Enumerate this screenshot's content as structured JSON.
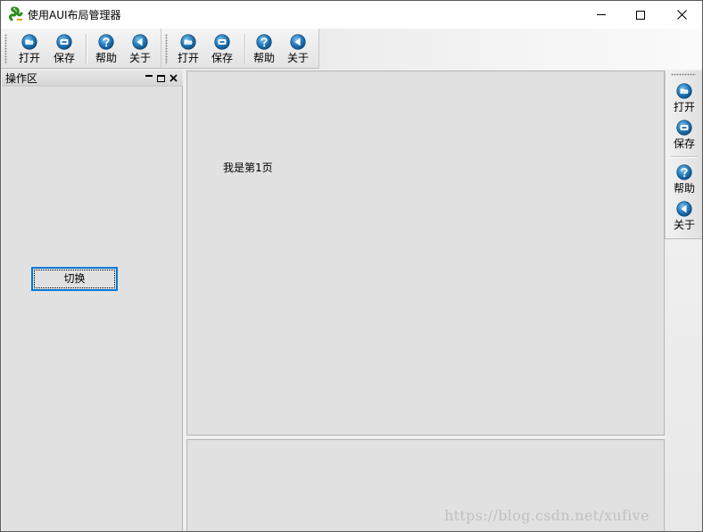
{
  "window": {
    "title": "使用AUI布局管理器",
    "app_icon": "snake-app-icon",
    "controls": {
      "minimize": "minimize-icon",
      "maximize": "maximize-icon",
      "close": "close-icon"
    }
  },
  "toolbar1": {
    "buttons": [
      {
        "label": "打开",
        "icon": "open-folder-icon"
      },
      {
        "label": "保存",
        "icon": "save-icon"
      },
      {
        "label": "帮助",
        "icon": "help-icon"
      },
      {
        "label": "关于",
        "icon": "back-arrow-icon"
      }
    ]
  },
  "toolbar2": {
    "buttons": [
      {
        "label": "打开",
        "icon": "open-folder-icon"
      },
      {
        "label": "保存",
        "icon": "save-icon"
      },
      {
        "label": "帮助",
        "icon": "help-icon"
      },
      {
        "label": "关于",
        "icon": "back-arrow-icon"
      }
    ]
  },
  "left_panel": {
    "caption": "操作区",
    "switch_label": "切换"
  },
  "center": {
    "page_text": "我是第1页"
  },
  "right_toolbar": {
    "buttons": [
      {
        "label": "打开",
        "icon": "open-folder-icon"
      },
      {
        "label": "保存",
        "icon": "save-icon"
      },
      {
        "label": "帮助",
        "icon": "help-icon"
      },
      {
        "label": "关于",
        "icon": "back-arrow-icon"
      }
    ]
  },
  "watermark": "https://blog.csdn.net/xufive",
  "colors": {
    "icon_blue": "#1f6fb0",
    "focus_border": "#0078d7",
    "panel_bg": "#e1e1e1"
  }
}
